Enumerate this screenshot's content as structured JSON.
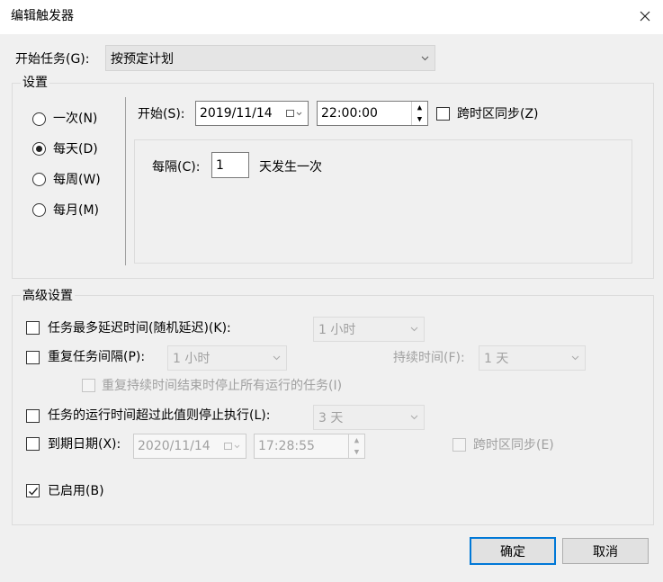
{
  "window": {
    "title": "编辑触发器"
  },
  "begin_task": {
    "label": "开始任务(G):",
    "value": "按预定计划"
  },
  "settings": {
    "group_label": "设置",
    "radios": [
      {
        "label": "一次(N)",
        "checked": false
      },
      {
        "label": "每天(D)",
        "checked": true
      },
      {
        "label": "每周(W)",
        "checked": false
      },
      {
        "label": "每月(M)",
        "checked": false
      }
    ],
    "start_label": "开始(S):",
    "start_date": "2019/11/14",
    "start_time": "22:00:00",
    "sync_timezone_label": "跨时区同步(Z)",
    "recur_label": "每隔(C):",
    "recur_value": "1",
    "recur_suffix": "天发生一次"
  },
  "advanced": {
    "group_label": "高级设置",
    "delay_label": "任务最多延迟时间(随机延迟)(K):",
    "delay_value": "1 小时",
    "repeat_label": "重复任务间隔(P):",
    "repeat_value": "1 小时",
    "duration_label": "持续时间(F):",
    "duration_value": "1 天",
    "stop_running_label": "重复持续时间结束时停止所有运行的任务(I)",
    "stop_if_longer_label": "任务的运行时间超过此值则停止执行(L):",
    "stop_if_longer_value": "3 天",
    "expire_label": "到期日期(X):",
    "expire_date": "2020/11/14",
    "expire_time": "17:28:55",
    "expire_sync_label": "跨时区同步(E)",
    "enabled_label": "已启用(B)",
    "enabled_checked": true
  },
  "buttons": {
    "ok": "确定",
    "cancel": "取消"
  }
}
